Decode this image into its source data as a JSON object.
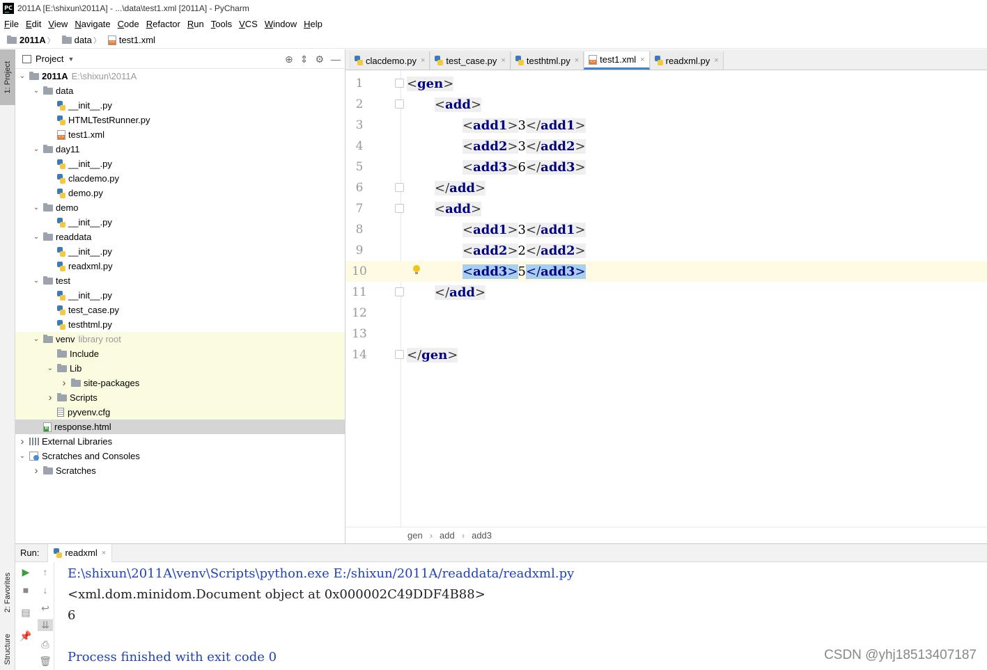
{
  "window": {
    "logo_text": "PC",
    "title": "2011A [E:\\shixun\\2011A] - ...\\data\\test1.xml [2011A] - PyCharm"
  },
  "menu": [
    {
      "u": "F",
      "rest": "ile"
    },
    {
      "u": "E",
      "rest": "dit"
    },
    {
      "u": "V",
      "rest": "iew"
    },
    {
      "u": "N",
      "rest": "avigate"
    },
    {
      "u": "C",
      "rest": "ode"
    },
    {
      "u": "R",
      "rest": "efactor"
    },
    {
      "u": "R",
      "rest": "un"
    },
    {
      "u": "T",
      "rest": "ools"
    },
    {
      "u": "V",
      "rest": "CS"
    },
    {
      "u": "W",
      "rest": "indow"
    },
    {
      "u": "H",
      "rest": "elp"
    }
  ],
  "navbar": {
    "project": "2011A",
    "folder": "data",
    "file": "test1.xml"
  },
  "left_strip": {
    "project_tab": "1: Project",
    "favorites_tab": "2: Favorites",
    "structure_tab": "Structure"
  },
  "project_panel": {
    "title": "Project",
    "tree": [
      {
        "label": "2011A",
        "hint": "E:\\shixun\\2011A",
        "depth": 0,
        "arrow": "down",
        "icon": "folder",
        "bold": true
      },
      {
        "label": "data",
        "depth": 1,
        "arrow": "down",
        "icon": "folder"
      },
      {
        "label": "__init__.py",
        "depth": 2,
        "icon": "py"
      },
      {
        "label": "HTMLTestRunner.py",
        "depth": 2,
        "icon": "py"
      },
      {
        "label": "test1.xml",
        "depth": 2,
        "icon": "xml"
      },
      {
        "label": "day11",
        "depth": 1,
        "arrow": "down",
        "icon": "folder"
      },
      {
        "label": "__init__.py",
        "depth": 2,
        "icon": "py"
      },
      {
        "label": "clacdemo.py",
        "depth": 2,
        "icon": "py"
      },
      {
        "label": "demo.py",
        "depth": 2,
        "icon": "py"
      },
      {
        "label": "demo",
        "depth": 1,
        "arrow": "down",
        "icon": "folder"
      },
      {
        "label": "__init__.py",
        "depth": 2,
        "icon": "py"
      },
      {
        "label": "readdata",
        "depth": 1,
        "arrow": "down",
        "icon": "folder"
      },
      {
        "label": "__init__.py",
        "depth": 2,
        "icon": "py"
      },
      {
        "label": "readxml.py",
        "depth": 2,
        "icon": "py"
      },
      {
        "label": "test",
        "depth": 1,
        "arrow": "down",
        "icon": "folder"
      },
      {
        "label": "__init__.py",
        "depth": 2,
        "icon": "py"
      },
      {
        "label": "test_case.py",
        "depth": 2,
        "icon": "py"
      },
      {
        "label": "testhtml.py",
        "depth": 2,
        "icon": "py"
      },
      {
        "label": "venv",
        "hint": "library root",
        "depth": 1,
        "arrow": "down",
        "icon": "folder",
        "yellow": true
      },
      {
        "label": "Include",
        "depth": 2,
        "icon": "folder",
        "yellow": true
      },
      {
        "label": "Lib",
        "depth": 2,
        "arrow": "down",
        "icon": "folder",
        "yellow": true
      },
      {
        "label": "site-packages",
        "depth": 3,
        "arrow": "right",
        "icon": "folder",
        "yellow": true
      },
      {
        "label": "Scripts",
        "depth": 2,
        "arrow": "right",
        "icon": "folder",
        "yellow": true
      },
      {
        "label": "pyvenv.cfg",
        "depth": 2,
        "icon": "cfg",
        "yellow": true
      },
      {
        "label": "response.html",
        "depth": 1,
        "icon": "html",
        "selected": true
      },
      {
        "label": "External Libraries",
        "depth": 0,
        "arrow": "right",
        "icon": "libs"
      },
      {
        "label": "Scratches and Consoles",
        "depth": 0,
        "arrow": "down",
        "icon": "scratch"
      },
      {
        "label": "Scratches",
        "depth": 1,
        "arrow": "right",
        "icon": "folder"
      }
    ]
  },
  "editor": {
    "tabs": [
      {
        "label": "clacdemo.py",
        "icon": "py"
      },
      {
        "label": "test_case.py",
        "icon": "py"
      },
      {
        "label": "testhtml.py",
        "icon": "py"
      },
      {
        "label": "test1.xml",
        "icon": "xml",
        "active": true
      },
      {
        "label": "readxml.py",
        "icon": "py"
      }
    ],
    "close_glyph": "×",
    "lines": [
      {
        "n": "1",
        "indent": 0,
        "parts": [
          {
            "t": "open",
            "name": "gen"
          }
        ],
        "fold": true
      },
      {
        "n": "2",
        "indent": 1,
        "parts": [
          {
            "t": "open",
            "name": "add"
          }
        ],
        "fold": true
      },
      {
        "n": "3",
        "indent": 2,
        "parts": [
          {
            "t": "open",
            "name": "add1"
          },
          {
            "t": "text",
            "v": "3"
          },
          {
            "t": "close",
            "name": "add1"
          }
        ]
      },
      {
        "n": "4",
        "indent": 2,
        "parts": [
          {
            "t": "open",
            "name": "add2"
          },
          {
            "t": "text",
            "v": "3"
          },
          {
            "t": "close",
            "name": "add2"
          }
        ]
      },
      {
        "n": "5",
        "indent": 2,
        "parts": [
          {
            "t": "open",
            "name": "add3"
          },
          {
            "t": "text",
            "v": "6"
          },
          {
            "t": "close",
            "name": "add3"
          }
        ]
      },
      {
        "n": "6",
        "indent": 1,
        "parts": [
          {
            "t": "close",
            "name": "add"
          }
        ],
        "fold": true
      },
      {
        "n": "7",
        "indent": 1,
        "parts": [
          {
            "t": "open",
            "name": "add"
          }
        ],
        "fold": true
      },
      {
        "n": "8",
        "indent": 2,
        "parts": [
          {
            "t": "open",
            "name": "add1"
          },
          {
            "t": "text",
            "v": "3"
          },
          {
            "t": "close",
            "name": "add1"
          }
        ]
      },
      {
        "n": "9",
        "indent": 2,
        "parts": [
          {
            "t": "open",
            "name": "add2"
          },
          {
            "t": "text",
            "v": "2"
          },
          {
            "t": "close",
            "name": "add2"
          }
        ]
      },
      {
        "n": "10",
        "indent": 2,
        "current": true,
        "bulb": true,
        "parts": [
          {
            "t": "open",
            "name": "add3",
            "hl": true
          },
          {
            "t": "text",
            "v": "5"
          },
          {
            "t": "close",
            "name": "add3",
            "hl": true
          }
        ]
      },
      {
        "n": "11",
        "indent": 1,
        "parts": [
          {
            "t": "close",
            "name": "add"
          }
        ],
        "fold": true
      },
      {
        "n": "12",
        "indent": 0,
        "parts": []
      },
      {
        "n": "13",
        "indent": 0,
        "parts": []
      },
      {
        "n": "14",
        "indent": 0,
        "parts": [
          {
            "t": "close",
            "name": "gen"
          }
        ],
        "fold": true
      }
    ],
    "breadcrumb": [
      "gen",
      "add",
      "add3"
    ]
  },
  "run_panel": {
    "label": "Run:",
    "tab": "readxml",
    "output": [
      {
        "text": "E:\\shixun\\2011A\\venv\\Scripts\\python.exe E:/shixun/2011A/readdata/readxml.py",
        "color": "blue"
      },
      {
        "text": "<xml.dom.minidom.Document object at 0x000002C49DDF4B88>",
        "color": "black"
      },
      {
        "text": "6",
        "color": "black"
      },
      {
        "text": "",
        "color": "black"
      },
      {
        "text": "Process finished with exit code 0",
        "color": "blue"
      }
    ]
  },
  "watermark": "CSDN @yhj18513407187"
}
